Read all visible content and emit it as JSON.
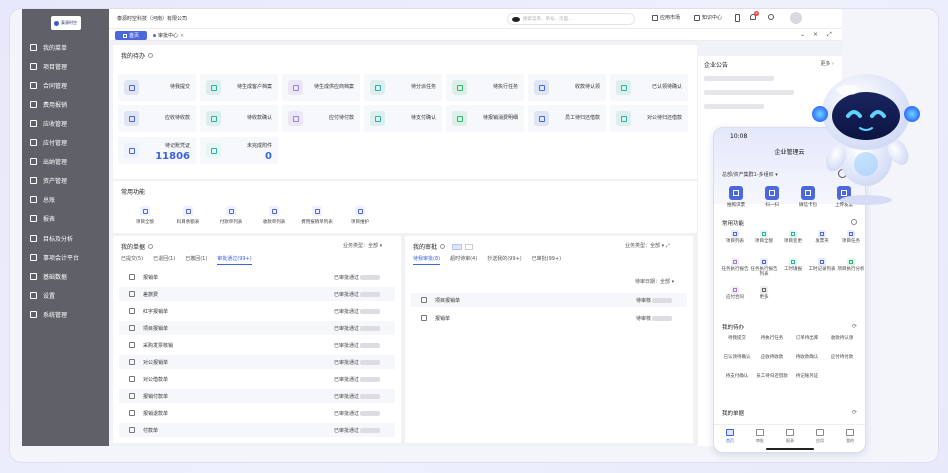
{
  "sidebar": {
    "logo_text": "泰源时空",
    "items": [
      {
        "label": "我的菜单",
        "icon": "star-icon"
      },
      {
        "label": "项目管理",
        "icon": "folder-icon"
      },
      {
        "label": "合同管理",
        "icon": "document-icon"
      },
      {
        "label": "费用报销",
        "icon": "receipt-icon"
      },
      {
        "label": "应收管理",
        "icon": "shield-icon"
      },
      {
        "label": "应付管理",
        "icon": "wallet-icon"
      },
      {
        "label": "出纳管理",
        "icon": "cashier-icon"
      },
      {
        "label": "资产管理",
        "icon": "asset-icon"
      },
      {
        "label": "总账",
        "icon": "ledger-icon"
      },
      {
        "label": "报表",
        "icon": "report-icon"
      },
      {
        "label": "目标及分析",
        "icon": "target-icon"
      },
      {
        "label": "事项会计平台",
        "icon": "platform-icon"
      },
      {
        "label": "基础数据",
        "icon": "chart-icon"
      },
      {
        "label": "设置",
        "icon": "gear-icon"
      },
      {
        "label": "系统管理",
        "icon": "tools-icon"
      }
    ]
  },
  "topbar": {
    "company": "泰源时空科技（河南）有限公司",
    "search_placeholder": "搜索菜单、单号、页面…",
    "app_market": "应用市场",
    "knowledge": "知识中心",
    "notify_count": "9"
  },
  "tabs": {
    "home": "首页",
    "approval": "审批中心"
  },
  "todo": {
    "title": "我的待办",
    "tiles": [
      {
        "label": "待我提交",
        "color": "#4b69dc"
      },
      {
        "label": "待生成客户档案",
        "color": "#2ab3a0"
      },
      {
        "label": "待生成供应商档案",
        "color": "#a07be0"
      },
      {
        "label": "待分派任务",
        "color": "#2ab3a0"
      },
      {
        "label": "待执行任务",
        "color": "#2db870"
      },
      {
        "label": "收款待认领",
        "color": "#4b69dc"
      },
      {
        "label": "已认领待确认",
        "color": "#2ab3a0"
      },
      {
        "label": "应收待收款",
        "color": "#4b69dc"
      },
      {
        "label": "待收款确认",
        "color": "#2ab3a0"
      },
      {
        "label": "应付待付款",
        "color": "#a07be0"
      },
      {
        "label": "待支付确认",
        "color": "#2ab3a0"
      },
      {
        "label": "待报销消费明细",
        "color": "#2db870"
      },
      {
        "label": "员工待归还借款",
        "color": "#4b69dc"
      },
      {
        "label": "对公待归还借款",
        "color": "#2ab3a0"
      }
    ],
    "pending_voucher": {
      "label": "待记账凭证",
      "value": "11806"
    },
    "unfinished": {
      "label": "未完成附件",
      "value": "0"
    }
  },
  "common": {
    "title": "常用功能",
    "items": [
      "项目全貌",
      "科目余额表",
      "付款单列表",
      "收款单列表",
      "费用报销单列表",
      "项目维护"
    ]
  },
  "mydocs": {
    "title": "我的单据",
    "filter_label": "业务类型：",
    "filter_value": "全部",
    "tabs": [
      "已提交(5)",
      "已退回(1)",
      "已撤回(1)",
      "审批通过(99+)"
    ],
    "rows": [
      {
        "name": "报销单",
        "status": "已审批通过"
      },
      {
        "name": "差旅费",
        "status": "已审批通过"
      },
      {
        "name": "红字报销单",
        "status": "已审批通过"
      },
      {
        "name": "项目报销单",
        "status": "已审批通过"
      },
      {
        "name": "采购发票核销",
        "status": "已审批通过"
      },
      {
        "name": "对公报销单",
        "status": "已审批通过"
      },
      {
        "name": "对公借款单",
        "status": "已审批通过"
      },
      {
        "name": "报销付款单",
        "status": "已审批通过"
      },
      {
        "name": "报销退款单",
        "status": "已审批通过"
      },
      {
        "name": "付款单",
        "status": "已审批通过"
      }
    ]
  },
  "approval": {
    "title": "我的审批",
    "filter_label": "业务类型：",
    "filter_value": "全部",
    "tabs": [
      "待我审批(8)",
      "超时待审(4)",
      "抄送我的(99+)",
      "已审批(99+)"
    ],
    "date_label": "待审日期：",
    "date_value": "全部",
    "rows": [
      {
        "name": "项目报销单",
        "status": "待审核"
      },
      {
        "name": "报销单",
        "status": "待审核"
      }
    ]
  },
  "announce": {
    "title": "企业公告",
    "more": "更多"
  },
  "phone": {
    "time": "10:08",
    "title": "企业管理云",
    "org": "总部/资产集群1-多组织",
    "quick": [
      "拍照识票",
      "扫一扫",
      "微信卡包",
      "上传发票"
    ],
    "common_title": "常用功能",
    "common": [
      {
        "label": "项目列表",
        "color": "#4b69dc"
      },
      {
        "label": "项目全貌",
        "color": "#2ab3a0"
      },
      {
        "label": "项目变更",
        "color": "#2ab3a0"
      },
      {
        "label": "发票夹",
        "color": "#4b69dc"
      },
      {
        "label": "项目任务",
        "color": "#4b69dc"
      },
      {
        "label": "任务执行报告",
        "color": "#a07be0"
      },
      {
        "label": "任务执行报告列表",
        "color": "#4b69dc"
      },
      {
        "label": "工时填报",
        "color": "#2ab3a0"
      },
      {
        "label": "工时记录列表",
        "color": "#4b69dc"
      },
      {
        "label": "项目执行分析",
        "color": "#2db870"
      },
      {
        "label": "应付合同",
        "color": "#a07be0"
      },
      {
        "label": "更多",
        "color": "#666666"
      }
    ],
    "todo_title": "我的待办",
    "todos": [
      "待我提交",
      "待执行任务",
      "订单待出库",
      "收款待认领",
      "已认领待确认",
      "应收待收款",
      "待收款确认",
      "应付待付款",
      "待支付确认",
      "员工待归还借款",
      "待记账凭证"
    ],
    "docs_title": "我的单据",
    "nav": [
      "首页",
      "审批",
      "报表",
      "应用",
      "我的"
    ]
  }
}
